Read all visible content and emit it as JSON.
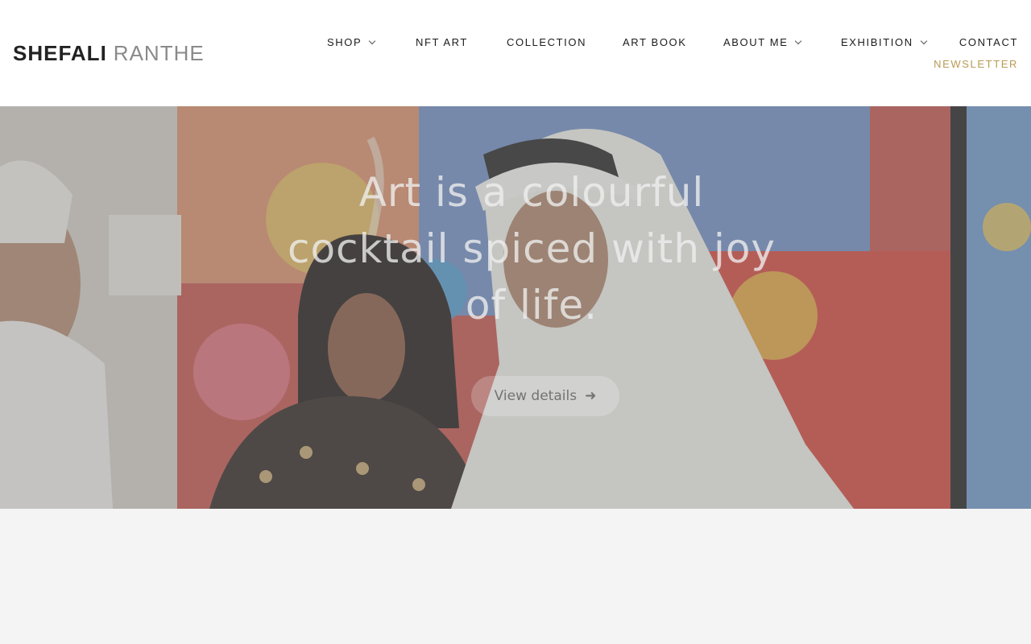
{
  "brand": {
    "first": "SHEFALI",
    "last": "RANTHE"
  },
  "nav": {
    "shop": "SHOP",
    "nft_art": "NFT ART",
    "collection": "COLLECTION",
    "art_book": "ART BOOK",
    "about_me": "ABOUT ME",
    "exhibition": "EXHIBITION",
    "contact": "CONTACT",
    "newsletter": "NEWSLETTER"
  },
  "hero": {
    "headline": "Art is a colourful cocktail spiced with joy of life.",
    "cta_label": "View details",
    "cta_icon": "arrow-right-icon"
  },
  "colors": {
    "newsletter_accent": "#b89a55",
    "nav_text": "#1c1c1c",
    "page_background": "#f4f4f4"
  }
}
